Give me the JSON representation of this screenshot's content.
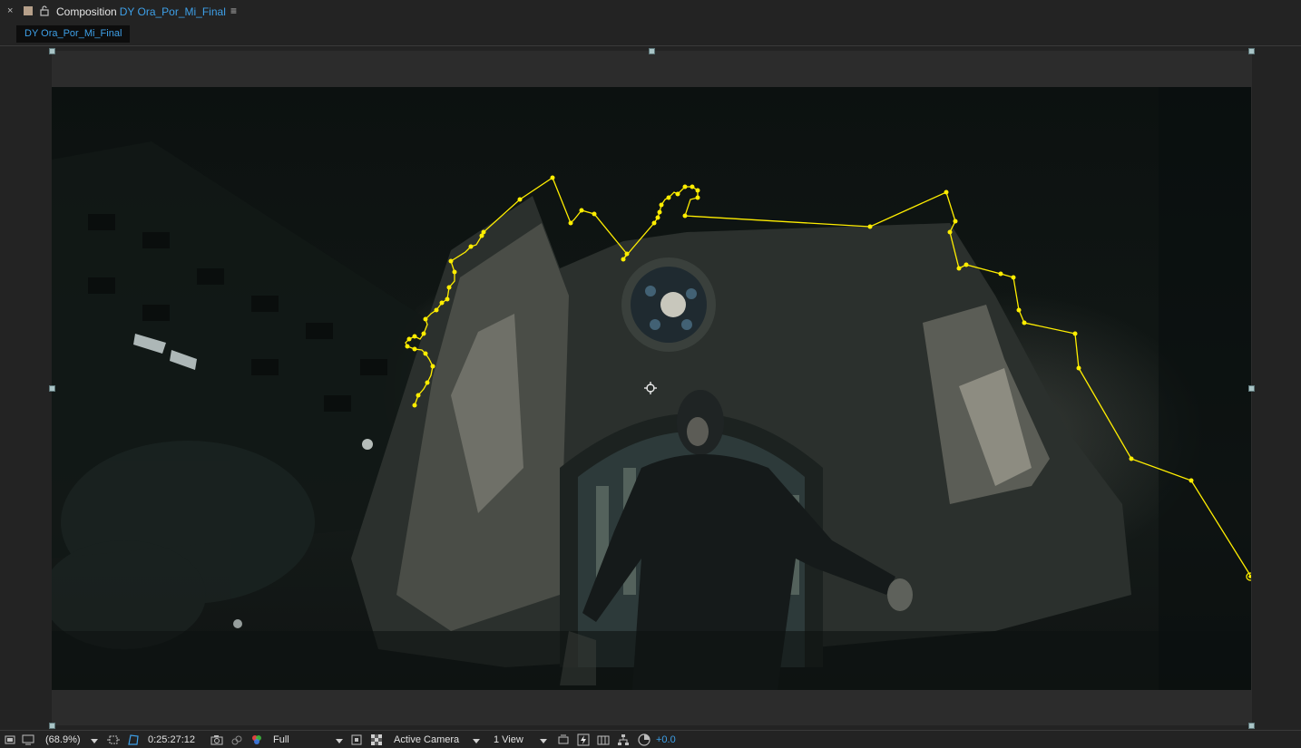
{
  "panel": {
    "label": "Composition",
    "comp_name": "DY Ora_Por_Mi_Final",
    "tab_label": "DY Ora_Por_Mi_Final",
    "close_symbol": "×",
    "menu_symbol": "≡"
  },
  "toolbar": {
    "magnification": "(68.9%)",
    "timecode": "0:25:27:12",
    "resolution": "Full",
    "camera": "Active Camera",
    "views": "1 View",
    "exposure": "+0.0"
  },
  "icons": {
    "close": "close-icon",
    "label_color": "label-color-swatch",
    "lock": "lock-icon",
    "menu": "panel-menu-icon",
    "always_preview": "always-preview-icon",
    "monitor": "monitor-icon",
    "region": "region-of-interest-icon",
    "transparency": "transparency-grid-icon",
    "snapshot": "camera-snapshot-icon",
    "show_snapshot": "show-snapshot-icon",
    "channels": "rgb-channels-icon",
    "fast_preview": "fast-previews-icon",
    "flowchart": "flowchart-icon",
    "reset_exposure": "reset-exposure-icon",
    "target": "anchor-point-icon"
  },
  "colors": {
    "accent": "#3ea0e8",
    "mask_path": "#ffee00",
    "handle": "#a9c4c6"
  }
}
